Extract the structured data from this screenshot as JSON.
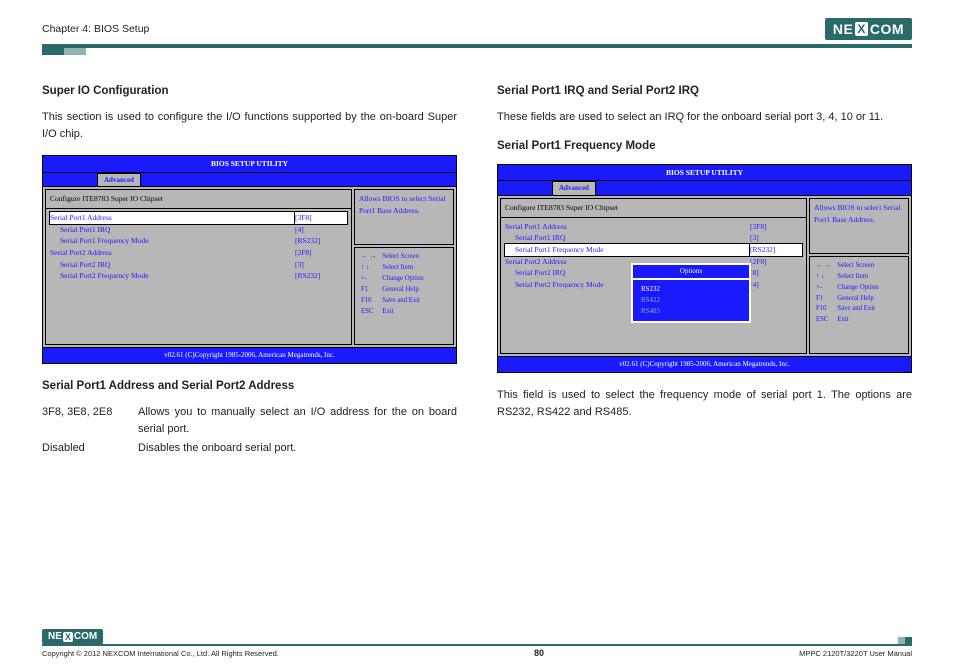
{
  "chapter": "Chapter 4: BIOS Setup",
  "brand": {
    "n": "NE",
    "x": "X",
    "com": "COM"
  },
  "left": {
    "h1": "Super IO Configuration",
    "p1": "This section is used to configure the I/O functions supported by the on-board Super I/O chip.",
    "bios": {
      "title": "BIOS SETUP UTILITY",
      "tab": "Advanced",
      "head": "Configure ITE8783 Super IO Chipset",
      "rows": [
        {
          "lbl": "Serial Port1 Address",
          "val": "[3F8]",
          "sel": true
        },
        {
          "lbl": "Serial Port1 IRQ",
          "val": "[4]",
          "indent": true
        },
        {
          "lbl": "Serial Port1 Frequency Mode",
          "val": "[RS232]",
          "indent": true
        },
        {
          "lbl": "Serial Port2 Address",
          "val": "[2F8]"
        },
        {
          "lbl": "Serial Port2 IRQ",
          "val": "[3]",
          "indent": true
        },
        {
          "lbl": "Serial Port2 Frequency Mode",
          "val": "[RS232]",
          "indent": true
        }
      ],
      "help": "Allows BIOS to select Serial Port1 Base Address.",
      "keys": [
        [
          "← →",
          "Select Screen"
        ],
        [
          "↑ ↓",
          "Select Item"
        ],
        [
          "+-",
          "Change Option"
        ],
        [
          "F1",
          "General Help"
        ],
        [
          "F10",
          "Save and Exit"
        ],
        [
          "ESC",
          "Exit"
        ]
      ],
      "foot": "v02.61 (C)Copyright 1985-2006, American Megatrends, Inc."
    },
    "h2": "Serial Port1 Address and Serial Port2 Address",
    "addr": [
      {
        "k": "3F8, 3E8, 2E8",
        "v": "Allows you to manually select an I/O address for the on board serial port."
      },
      {
        "k": "Disabled",
        "v": "Disables the onboard serial port."
      }
    ]
  },
  "right": {
    "h1": "Serial Port1 IRQ and Serial Port2 IRQ",
    "p1": "These fields are used to select an IRQ for the onboard serial port 3, 4, 10 or 11.",
    "h2": "Serial Port1 Frequency Mode",
    "bios": {
      "title": "BIOS SETUP UTILITY",
      "tab": "Advanced",
      "head": "Configure ITE8783 Super IO Chipset",
      "rows": [
        {
          "lbl": "Serial Port1 Address",
          "val": "[3F8]"
        },
        {
          "lbl": "Serial Port1 IRQ",
          "val": "[3]",
          "indent": true
        },
        {
          "lbl": "Serial Port1 Frequency Mode",
          "val": "[RS232]",
          "indent": true,
          "sel": true
        },
        {
          "lbl": "Serial Port2 Address",
          "val": "[2F8]"
        },
        {
          "lbl": "Serial Port2 IRQ",
          "val": "[8]",
          "indent": true
        },
        {
          "lbl": "Serial Port2 Frequency Mode",
          "val": "[4]",
          "indent": true
        }
      ],
      "popup": {
        "title": "Options",
        "opts": [
          "RS232",
          "RS422",
          "RS485"
        ],
        "active": 0
      },
      "help": "Allows BIOS to select Serial Port1 Base Address.",
      "keys": [
        [
          "← →",
          "Select Screen"
        ],
        [
          "↑ ↓",
          "Select Item"
        ],
        [
          "+-",
          "Change Option"
        ],
        [
          "F1",
          "General Help"
        ],
        [
          "F10",
          "Save and Exit"
        ],
        [
          "ESC",
          "Exit"
        ]
      ],
      "foot": "v02.61 (C)Copyright 1985-2006, American Megatrends, Inc."
    },
    "p2": "This field is used to select the frequency mode of serial port 1. The options are RS232, RS422 and RS485."
  },
  "footer": {
    "copyright": "Copyright © 2012 NEXCOM International Co., Ltd. All Rights Reserved.",
    "page": "80",
    "manual": "MPPC 2120T/3220T User Manual"
  }
}
